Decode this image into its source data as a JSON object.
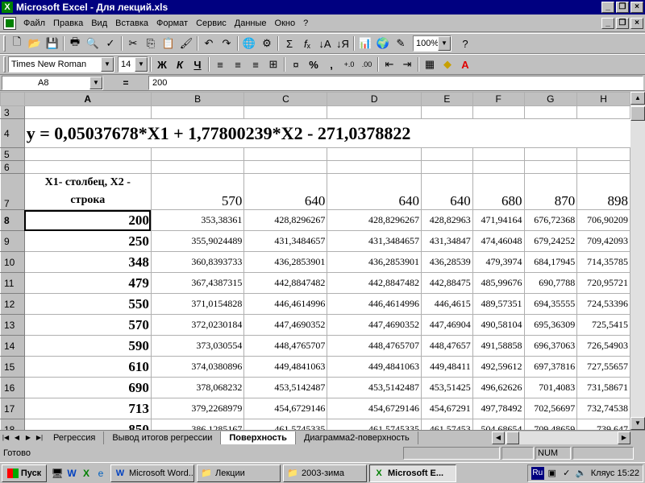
{
  "window": {
    "title": "Microsoft Excel - Для лекций.xls"
  },
  "menu": [
    "Файл",
    "Правка",
    "Вид",
    "Вставка",
    "Формат",
    "Сервис",
    "Данные",
    "Окно",
    "?"
  ],
  "toolbar": {
    "zoom": "100%",
    "font_name": "Times New Roman",
    "font_size": "14",
    "bold": "Ж",
    "italic": "К",
    "underline": "Ч",
    "percent": "%",
    "comma": ","
  },
  "formula_bar": {
    "name_box": "A8",
    "eq": "=",
    "formula": "200"
  },
  "sheet": {
    "columns": [
      "A",
      "B",
      "C",
      "D",
      "E",
      "F",
      "G",
      "H"
    ],
    "row3": "3",
    "row4": "4",
    "row5": "5",
    "row6": "6",
    "row7": "7",
    "equation": "y = 0,05037678*X1 + 1,77800239*X2 - 271,0378822",
    "x_header": "X1- столбец, X2 - строка",
    "header_values": [
      "570",
      "640",
      "640",
      "640",
      "680",
      "870",
      "898"
    ],
    "rows": [
      {
        "n": "8",
        "a": "200",
        "v": [
          "353,38361",
          "428,8296267",
          "428,8296267",
          "428,82963",
          "471,94164",
          "676,72368",
          "706,90209"
        ]
      },
      {
        "n": "9",
        "a": "250",
        "v": [
          "355,9024489",
          "431,3484657",
          "431,3484657",
          "431,34847",
          "474,46048",
          "679,24252",
          "709,42093"
        ]
      },
      {
        "n": "10",
        "a": "348",
        "v": [
          "360,8393733",
          "436,2853901",
          "436,2853901",
          "436,28539",
          "479,3974",
          "684,17945",
          "714,35785"
        ]
      },
      {
        "n": "11",
        "a": "479",
        "v": [
          "367,4387315",
          "442,8847482",
          "442,8847482",
          "442,88475",
          "485,99676",
          "690,7788",
          "720,95721"
        ]
      },
      {
        "n": "12",
        "a": "550",
        "v": [
          "371,0154828",
          "446,4614996",
          "446,4614996",
          "446,4615",
          "489,57351",
          "694,35555",
          "724,53396"
        ]
      },
      {
        "n": "13",
        "a": "570",
        "v": [
          "372,0230184",
          "447,4690352",
          "447,4690352",
          "447,46904",
          "490,58104",
          "695,36309",
          "725,5415"
        ]
      },
      {
        "n": "14",
        "a": "590",
        "v": [
          "373,030554",
          "448,4765707",
          "448,4765707",
          "448,47657",
          "491,58858",
          "696,37063",
          "726,54903"
        ]
      },
      {
        "n": "15",
        "a": "610",
        "v": [
          "374,0380896",
          "449,4841063",
          "449,4841063",
          "449,48411",
          "492,59612",
          "697,37816",
          "727,55657"
        ]
      },
      {
        "n": "16",
        "a": "690",
        "v": [
          "378,068232",
          "453,5142487",
          "453,5142487",
          "453,51425",
          "496,62626",
          "701,4083",
          "731,58671"
        ]
      },
      {
        "n": "17",
        "a": "713",
        "v": [
          "379,2268979",
          "454,6729146",
          "454,6729146",
          "454,67291",
          "497,78492",
          "702,56697",
          "732,74538"
        ]
      },
      {
        "n": "18",
        "a": "850",
        "v": [
          "386,1285167",
          "461,5745335",
          "461,5745335",
          "461,57453",
          "504,68654",
          "709,48659",
          "739,647"
        ]
      }
    ]
  },
  "tabs": [
    "Регрессия",
    "Вывод итогов регрессии",
    "Поверхность",
    "Диаграмма2-поверхность"
  ],
  "active_tab": "Поверхность",
  "status": {
    "ready": "Готово",
    "num": "NUM"
  },
  "taskbar": {
    "start": "Пуск",
    "buttons": [
      "Microsoft Word...",
      "Лекции",
      "2003-зима",
      "Microsoft E..."
    ],
    "lang": "Ru",
    "clock": "Кляус 15:22"
  }
}
